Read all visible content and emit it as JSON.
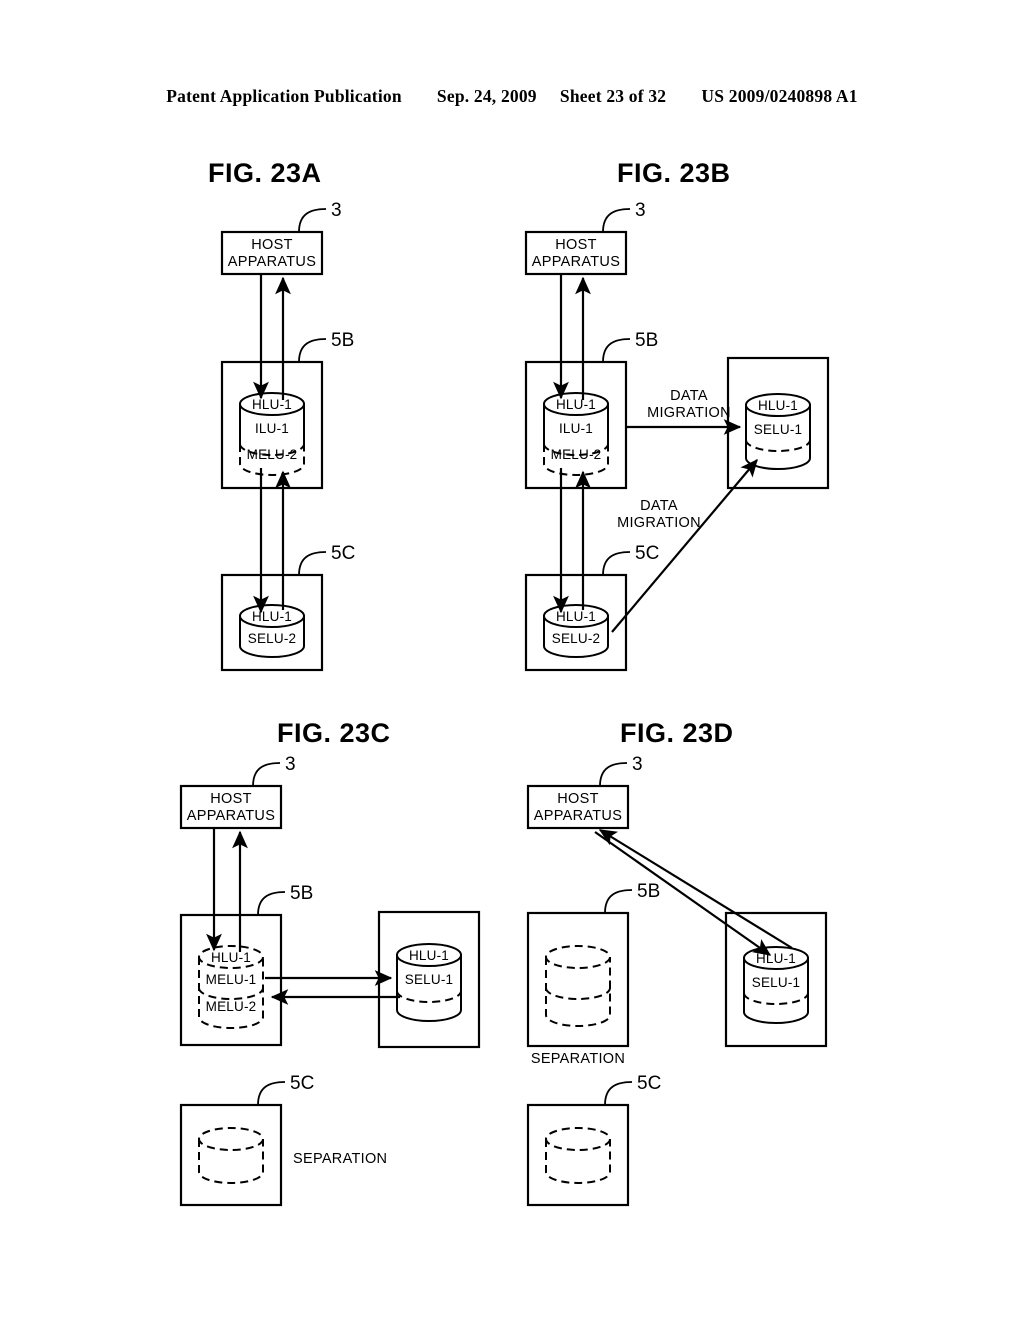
{
  "header": {
    "publication": "Patent Application Publication",
    "date": "Sep. 24, 2009",
    "sheet": "Sheet 23 of 32",
    "patent_number": "US 2009/0240898 A1"
  },
  "figures": [
    {
      "id": "23A",
      "title": "FIG. 23A",
      "refs": {
        "host": "3",
        "storage_upper": "5B",
        "storage_lower": "5C"
      },
      "host_label_line1": "HOST",
      "host_label_line2": "APPARATUS",
      "upper_cylinder": {
        "top": "HLU-1",
        "mid": "ILU-1",
        "bottom": "MELU-2"
      },
      "lower_cylinder": {
        "top": "HLU-1",
        "body": "SELU-2"
      }
    },
    {
      "id": "23B",
      "title": "FIG. 23B",
      "refs": {
        "host": "3",
        "storage_upper": "5B",
        "storage_lower": "5C"
      },
      "host_label_line1": "HOST",
      "host_label_line2": "APPARATUS",
      "upper_cylinder": {
        "top": "HLU-1",
        "mid": "ILU-1",
        "bottom": "MELU-2"
      },
      "lower_cylinder": {
        "top": "HLU-1",
        "body": "SELU-2"
      },
      "target_cylinder": {
        "top": "HLU-1",
        "body": "SELU-1"
      },
      "annotation_1_line1": "DATA",
      "annotation_1_line2": "MIGRATION",
      "annotation_2_line1": "DATA",
      "annotation_2_line2": "MIGRATION"
    },
    {
      "id": "23C",
      "title": "FIG. 23C",
      "refs": {
        "host": "3",
        "storage_upper": "5B",
        "storage_lower": "5C"
      },
      "host_label_line1": "HOST",
      "host_label_line2": "APPARATUS",
      "upper_cylinder": {
        "top": "HLU-1",
        "mid": "MELU-1",
        "bottom": "MELU-2"
      },
      "target_cylinder": {
        "top": "HLU-1",
        "body": "SELU-1"
      },
      "separation_label": "SEPARATION"
    },
    {
      "id": "23D",
      "title": "FIG. 23D",
      "refs": {
        "host": "3",
        "storage_upper": "5B",
        "storage_lower": "5C"
      },
      "host_label_line1": "HOST",
      "host_label_line2": "APPARATUS",
      "target_cylinder": {
        "top": "HLU-1",
        "body": "SELU-1"
      },
      "separation_label": "SEPARATION"
    }
  ],
  "colors": {
    "ink": "#000000",
    "paper": "#ffffff"
  }
}
